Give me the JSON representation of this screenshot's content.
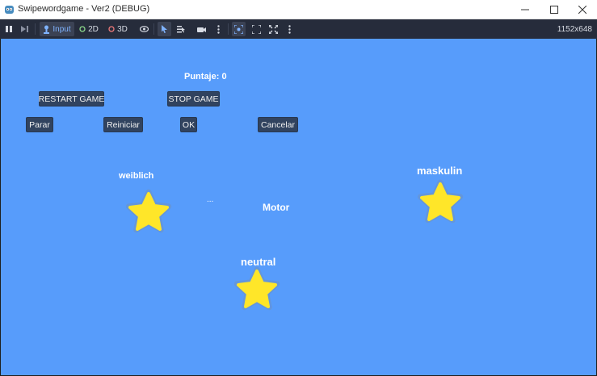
{
  "window": {
    "title": "Swipewordgame - Ver2 (DEBUG)"
  },
  "toolbar": {
    "input_label": "Input",
    "mode_2d_label": "2D",
    "mode_3d_label": "3D",
    "resolution": "1152x648"
  },
  "game": {
    "score_text": "Puntaje: 0",
    "buttons": {
      "restart": "RESTART GAME",
      "stop": "STOP GAME",
      "parar": "Parar",
      "reiniciar": "Reiniciar",
      "ok": "OK",
      "cancelar": "Cancelar"
    },
    "categories": {
      "feminine": "weiblich",
      "masculine": "maskulin",
      "neuter": "neutral"
    },
    "current_word": "Motor",
    "ellipsis": "..."
  },
  "colors": {
    "background": "#579cfb",
    "star": "#ffe629",
    "button": "#31435f",
    "toolbar": "#262c3b"
  }
}
